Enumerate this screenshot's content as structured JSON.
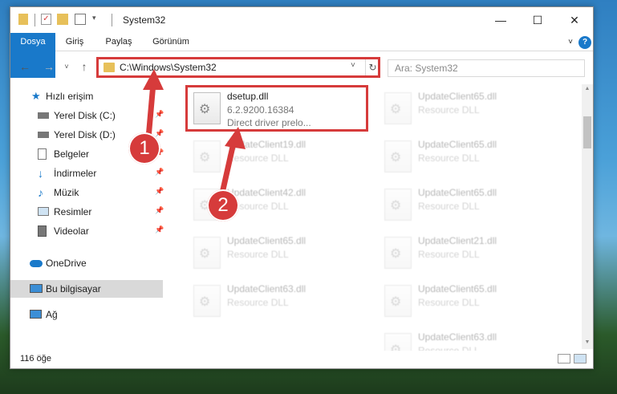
{
  "window": {
    "title": "System32"
  },
  "ribbon": {
    "tabs": [
      "Dosya",
      "Giriş",
      "Paylaş",
      "Görünüm"
    ]
  },
  "address": {
    "path": "C:\\Windows\\System32",
    "search_placeholder": "Ara: System32"
  },
  "sidebar": {
    "items": [
      {
        "label": "Hızlı erişim",
        "icon": "star-icon"
      },
      {
        "label": "Yerel Disk (C:)",
        "icon": "drive-icon"
      },
      {
        "label": "Yerel Disk (D:)",
        "icon": "drive-icon"
      },
      {
        "label": "Belgeler",
        "icon": "documents-icon"
      },
      {
        "label": "İndirmeler",
        "icon": "download-icon"
      },
      {
        "label": "Müzik",
        "icon": "music-icon"
      },
      {
        "label": "Resimler",
        "icon": "pictures-icon"
      },
      {
        "label": "Videolar",
        "icon": "videos-icon"
      },
      {
        "label": "OneDrive",
        "icon": "cloud-icon"
      },
      {
        "label": "Bu bilgisayar",
        "icon": "computer-icon"
      },
      {
        "label": "Ağ",
        "icon": "network-icon"
      }
    ]
  },
  "files": {
    "main": {
      "name": "dsetup.dll",
      "version": "6.2.9200.16384",
      "description": "Direct driver prelo..."
    },
    "others": [
      {
        "name": "UpdateClient65.dll",
        "type": "Resource DLL"
      },
      {
        "name": "UpdateClient65.dll",
        "type": "Resource DLL"
      },
      {
        "name": "UpdateClient19.dll",
        "type": "Resource DLL"
      },
      {
        "name": "UpdateClient65.dll",
        "type": "Resource DLL"
      },
      {
        "name": "UpdateClient42.dll",
        "type": "Resource DLL"
      },
      {
        "name": "UpdateClient21.dll",
        "type": "Resource DLL"
      },
      {
        "name": "UpdateClient65.dll",
        "type": "Resource DLL"
      },
      {
        "name": "UpdateClient65.dll",
        "type": "Resource DLL"
      },
      {
        "name": "UpdateClient63.dll",
        "type": "Resource DLL"
      },
      {
        "name": "UpdateClient63.dll",
        "type": "Resource DLL"
      }
    ]
  },
  "status": {
    "count": "116 öğe"
  },
  "annotations": {
    "step1": "1",
    "step2": "2"
  },
  "colors": {
    "accent": "#1979ca",
    "highlight": "#d63b3b"
  }
}
